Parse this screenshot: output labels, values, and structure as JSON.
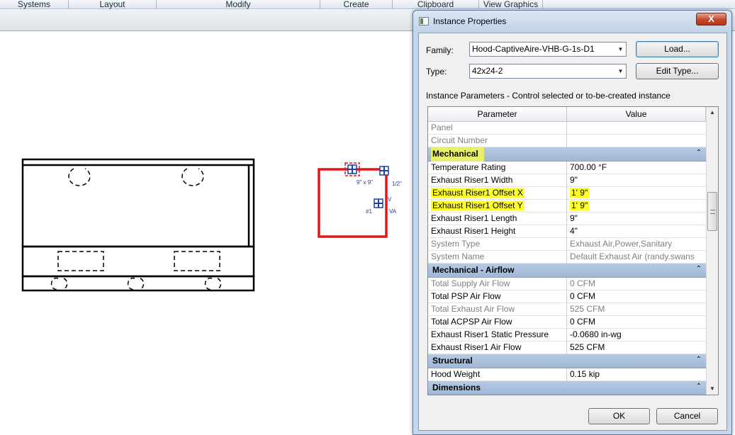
{
  "ribbon": {
    "tabs": [
      {
        "label": "Systems"
      },
      {
        "label": "Layout"
      },
      {
        "label": "Modify"
      },
      {
        "label": "Create"
      },
      {
        "label": "Clipboard"
      },
      {
        "label": "View Graphics"
      }
    ]
  },
  "canvas": {
    "labels": {
      "dim": "9\" x 9\"",
      "half": "1/2\"",
      "v": "V",
      "num": "#1",
      "va": "VA"
    },
    "colors": {
      "selection": "#e0171c",
      "connector": "#1f3fa0"
    }
  },
  "dialog": {
    "title": "Instance Properties",
    "close_glyph": "X",
    "family_label": "Family:",
    "family_value": "Hood-CaptiveAire-VHB-G-1s-D1",
    "type_label": "Type:",
    "type_value": "42x24-2",
    "load_button": "Load...",
    "edit_type_button": "Edit Type...",
    "instance_note": "Instance Parameters - Control selected or to-be-created instance",
    "grid_headers": {
      "parameter": "Parameter",
      "value": "Value"
    },
    "rows": [
      {
        "kind": "row",
        "name": "Panel",
        "value": "",
        "readonly": true
      },
      {
        "kind": "row",
        "name": "Circuit Number",
        "value": "",
        "readonly": true
      },
      {
        "kind": "group",
        "name": "Mechanical",
        "highlight": true
      },
      {
        "kind": "row",
        "name": "Temperature Rating",
        "value": "700.00 °F"
      },
      {
        "kind": "row",
        "name": "Exhaust Riser1 Width",
        "value": "9\""
      },
      {
        "kind": "row",
        "name": "Exhaust Riser1 Offset X",
        "value": "1'  9\"",
        "highlight": true
      },
      {
        "kind": "row",
        "name": "Exhaust Riser1 Offset Y",
        "value": "1'  9\"",
        "highlight": true
      },
      {
        "kind": "row",
        "name": "Exhaust Riser1 Length",
        "value": "9\""
      },
      {
        "kind": "row",
        "name": "Exhaust Riser1 Height",
        "value": "4\""
      },
      {
        "kind": "row",
        "name": "System Type",
        "value": "Exhaust Air,Power,Sanitary",
        "readonly": true
      },
      {
        "kind": "row",
        "name": "System Name",
        "value": "Default Exhaust Air (randy.swans",
        "readonly": true
      },
      {
        "kind": "group",
        "name": "Mechanical - Airflow"
      },
      {
        "kind": "row",
        "name": "Total Supply Air Flow",
        "value": "0 CFM",
        "readonly": true
      },
      {
        "kind": "row",
        "name": "Total PSP Air Flow",
        "value": "0 CFM"
      },
      {
        "kind": "row",
        "name": "Total Exhaust Air Flow",
        "value": "525 CFM",
        "readonly": true
      },
      {
        "kind": "row",
        "name": "Total ACPSP Air Flow",
        "value": "0 CFM"
      },
      {
        "kind": "row",
        "name": "Exhaust Riser1 Static Pressure",
        "value": "-0.0680 in-wg"
      },
      {
        "kind": "row",
        "name": "Exhaust Riser1 Air Flow",
        "value": "525 CFM"
      },
      {
        "kind": "group",
        "name": "Structural"
      },
      {
        "kind": "row",
        "name": "Hood Weight",
        "value": "0.15 kip"
      },
      {
        "kind": "group",
        "name": "Dimensions"
      }
    ],
    "ok_button": "OK",
    "cancel_button": "Cancel",
    "highlight_color": "#ffff2e"
  }
}
